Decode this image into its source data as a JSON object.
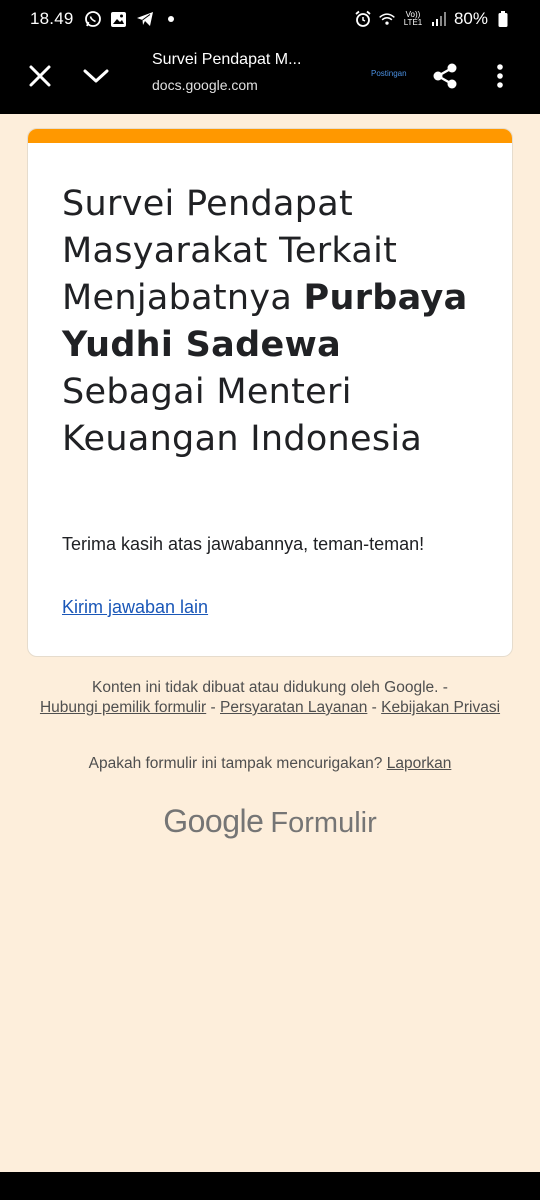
{
  "status_bar": {
    "time": "18.49",
    "battery": "80%",
    "icons_left": [
      "whatsapp-icon",
      "gallery-icon",
      "telegram-icon",
      "dot-icon"
    ],
    "icons_right": [
      "alarm-icon",
      "wifi-icon",
      "volte-icon",
      "signal-icon",
      "battery-icon"
    ],
    "volte_label": "Vo)) LTE1"
  },
  "toolbar": {
    "title": "Survei Pendapat M...",
    "url": "docs.google.com",
    "post_label": "Postingan"
  },
  "form": {
    "accent_color": "#ff9800",
    "title_part1": "Survei Pendapat Masyarakat Terkait Menjabatnya ",
    "title_bold": "Purbaya Yudhi Sadewa",
    "title_part2": " Sebagai Menteri Keuangan Indonesia",
    "confirmation": "Terima kasih atas jawabannya, teman-teman!",
    "another_response": "Kirim jawaban lain"
  },
  "footer": {
    "disclaimer": "Konten ini tidak dibuat atau didukung oleh Google. -",
    "contact_owner": "Hubungi pemilik formulir",
    "sep1": " - ",
    "terms": "Persyaratan Layanan",
    "sep2": " - ",
    "privacy": "Kebijakan Privasi",
    "suspicious": "Apakah formulir ini tampak mencurigakan?",
    "report": "Laporkan",
    "brand_google": "Google",
    "brand_forms": "Formulir"
  }
}
